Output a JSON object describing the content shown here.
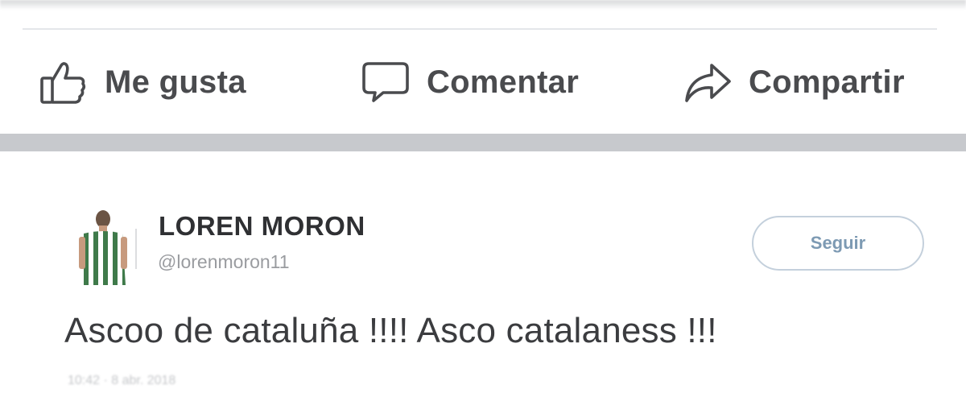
{
  "actions": {
    "like": {
      "label": "Me gusta",
      "icon": "thumbs-up-icon"
    },
    "comment": {
      "label": "Comentar",
      "icon": "speech-bubble-icon"
    },
    "share": {
      "label": "Compartir",
      "icon": "share-arrow-icon"
    }
  },
  "tweet": {
    "author_name": "LOREN MORON",
    "handle": "@lorenmoron11",
    "follow_label": "Seguir",
    "text": "Ascoo de cataluña !!!! Asco catalaness !!!",
    "timestamp": "10:42 · 8 abr. 2018",
    "avatar": "avatar-player-photo"
  },
  "colors": {
    "label_gray": "#4a4b4e",
    "separator": "#c7c9cd",
    "follow_blue": "#7d9ab3",
    "follow_border": "#c4d0dc"
  }
}
